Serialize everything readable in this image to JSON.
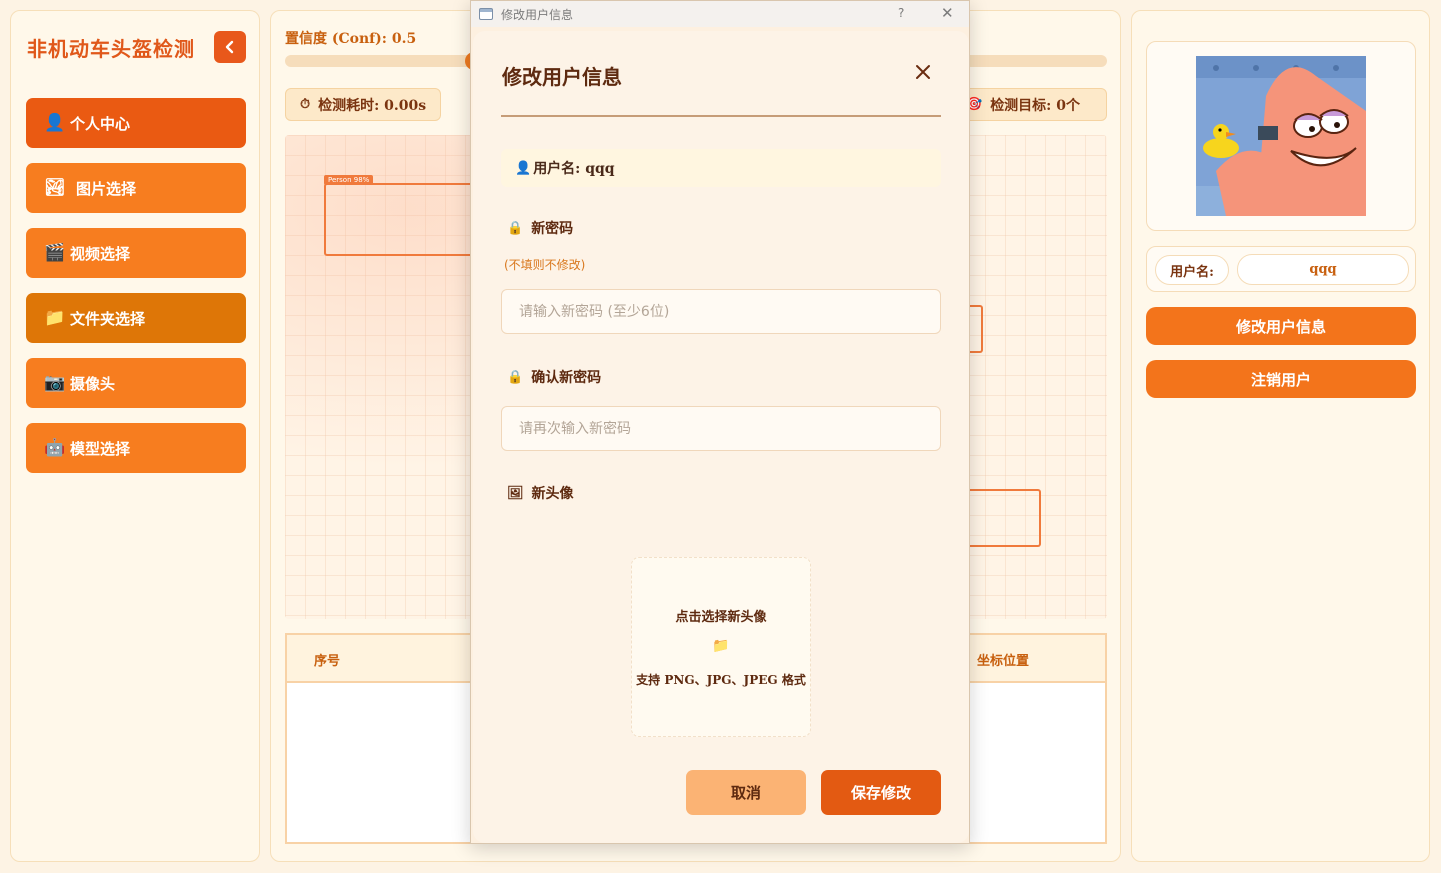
{
  "sidebar": {
    "title": "非机动车头盔检测",
    "items": [
      {
        "icon": "👤",
        "label": "个人中心"
      },
      {
        "icon": "🏞",
        "label": "图片选择"
      },
      {
        "icon": "🎬",
        "label": "视频选择"
      },
      {
        "icon": "📁",
        "label": "文件夹选择"
      },
      {
        "icon": "📷",
        "label": "摄像头"
      },
      {
        "icon": "🤖",
        "label": "模型选择"
      }
    ]
  },
  "center": {
    "conf_label": "置信度 (Conf): 0.5",
    "conf_value": 0.5,
    "stats": {
      "time_icon": "⏱",
      "time_label": "检测耗时: 0.00s",
      "targets_icon": "🎯",
      "targets_label": "检测目标: 0个"
    },
    "detection_label": "Person 98%",
    "table": {
      "col_index": "序号",
      "col_position": "坐标位置"
    }
  },
  "right": {
    "username_tag": "用户名:",
    "username_value": "qqq",
    "edit_button": "修改用户信息",
    "logout_button": "注销用户"
  },
  "dialog": {
    "window_title": "修改用户信息",
    "window_help": "?",
    "title": "修改用户信息",
    "username_icon": "👤",
    "username_line": "用户名: qqq",
    "new_password_icon": "🔒",
    "new_password_label": "新密码",
    "hint": "(不填则不修改)",
    "new_password_placeholder": "请输入新密码 (至少6位)",
    "confirm_icon": "🔒",
    "confirm_label": "确认新密码",
    "confirm_placeholder": "请再次输入新密码",
    "avatar_icon": "🖼",
    "avatar_label": "新头像",
    "upload_title": "点击选择新头像",
    "upload_icon": "📁",
    "upload_formats": "支持 PNG、JPG、JPEG 格式",
    "cancel": "取消",
    "save": "保存修改"
  },
  "colors": {
    "accent": "#f77d1f",
    "accent_dark": "#e35a12",
    "panel": "#fff8ea"
  }
}
